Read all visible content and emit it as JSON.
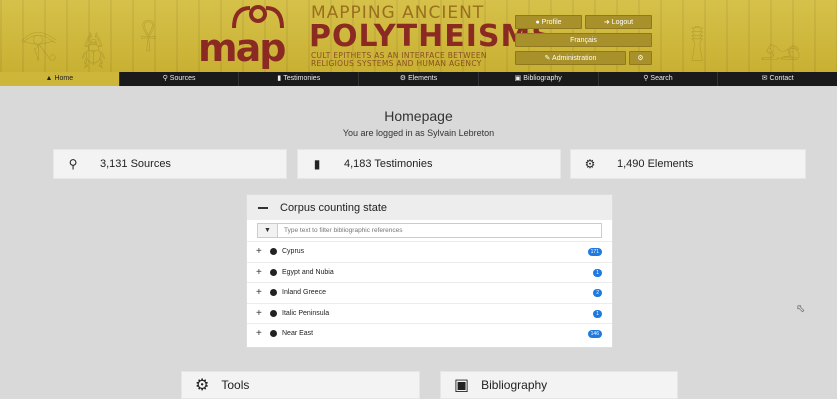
{
  "header": {
    "logo_text": "map",
    "title_line1": "MAPPING ANCIENT",
    "title_line2": "POLYTHEISMS",
    "subtitle_line1": "CULT EPITHETS AS AN INTERFACE BETWEEN",
    "subtitle_line2": "RELIGIOUS SYSTEMS AND HUMAN AGENCY",
    "profile_label": "Profile",
    "logout_label": "Logout",
    "language_label": "Français",
    "admin_label": "Administration"
  },
  "nav": {
    "items": [
      {
        "label": "Home",
        "icon": "home-icon"
      },
      {
        "label": "Sources",
        "icon": "pin-icon"
      },
      {
        "label": "Testimonies",
        "icon": "file-icon"
      },
      {
        "label": "Elements",
        "icon": "cog-icon"
      },
      {
        "label": "Bibliography",
        "icon": "book-icon"
      },
      {
        "label": "Search",
        "icon": "search-icon"
      },
      {
        "label": "Contact",
        "icon": "envelope-icon"
      }
    ]
  },
  "main": {
    "title": "Homepage",
    "logged_in": "You are logged in as Sylvain Lebreton",
    "stats": [
      {
        "label": "3,131 Sources"
      },
      {
        "label": "4,183 Testimonies"
      },
      {
        "label": "1,490 Elements"
      }
    ],
    "corpus": {
      "title": "Corpus counting state",
      "filter_placeholder": "Type text to filter bibliographic references",
      "rows": [
        {
          "label": "Cyprus",
          "badge": "171"
        },
        {
          "label": "Egypt and Nubia",
          "badge": "1"
        },
        {
          "label": "Inland Greece",
          "badge": "2"
        },
        {
          "label": "Italic Peninsula",
          "badge": "1"
        },
        {
          "label": "Near East",
          "badge": "146"
        }
      ]
    },
    "tools_title": "Tools",
    "bibliography_title": "Bibliography"
  },
  "colors": {
    "banner": "#cdb63a",
    "nav_bg": "#1a1a1a",
    "brand_red": "#8a2a22",
    "badge_blue": "#1f7ae0"
  }
}
